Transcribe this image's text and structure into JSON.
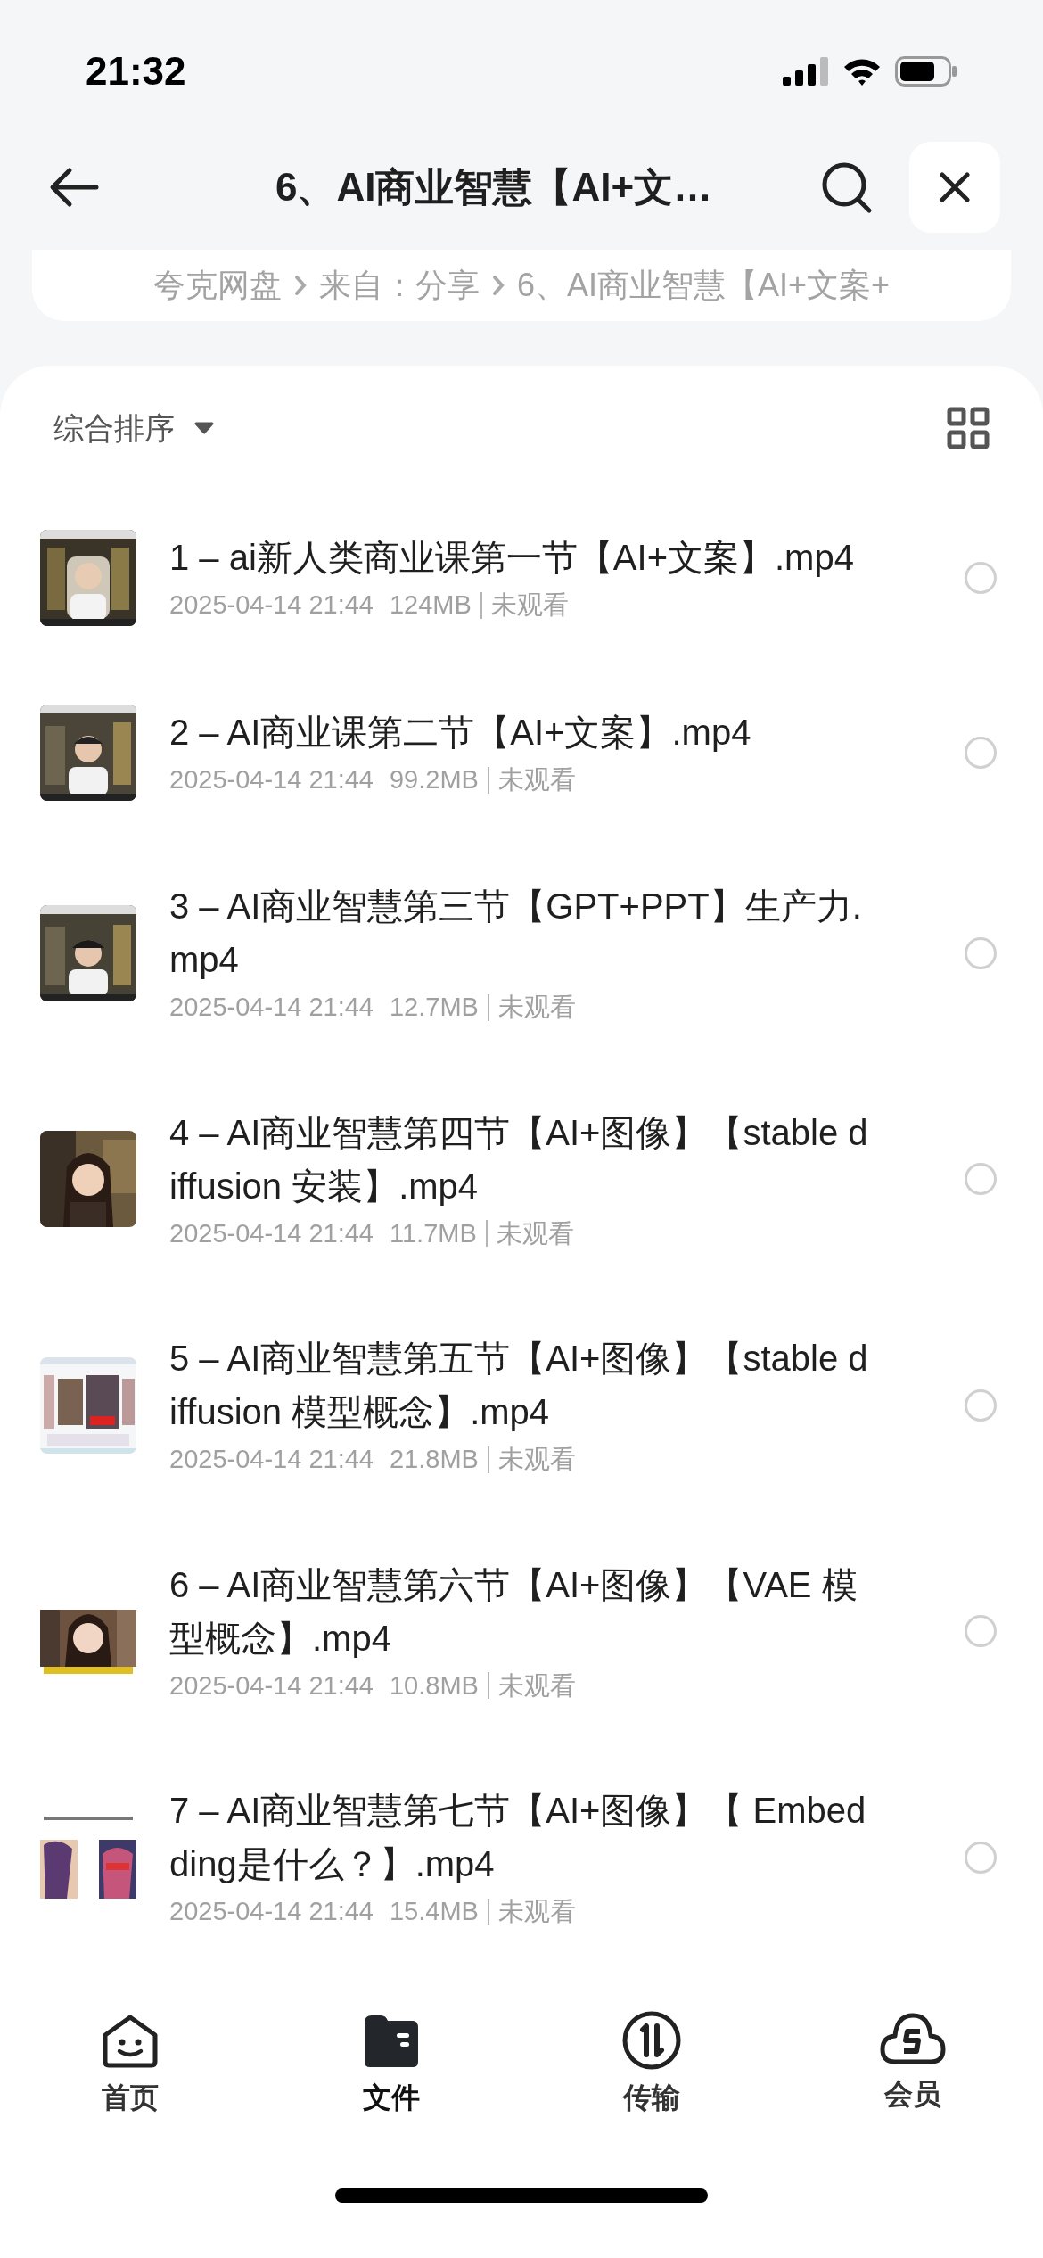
{
  "status_bar": {
    "time": "21:32"
  },
  "header": {
    "title": "6、AI商业智慧【AI+文…"
  },
  "breadcrumb": [
    "夸克网盘",
    "来自：分享",
    "6、AI商业智慧【AI+文案+"
  ],
  "sort": {
    "label": "综合排序"
  },
  "files": [
    {
      "name": "1 – ai新人类商业课第一节【AI+文案】.mp4",
      "date": "2025-04-14 21:44",
      "size": "124MB",
      "watch": "未观看",
      "checked": false
    },
    {
      "name": "2 – AI商业课第二节【AI+文案】.mp4",
      "date": "2025-04-14 21:44",
      "size": "99.2MB",
      "watch": "未观看",
      "checked": false
    },
    {
      "name": "3 – AI商业智慧第三节【GPT+PPT】生产力.mp4",
      "date": "2025-04-14 21:44",
      "size": "12.7MB",
      "watch": "未观看",
      "checked": false
    },
    {
      "name": "4 – AI商业智慧第四节【AI+图像】【stable diffusion 安装】.mp4",
      "date": "2025-04-14 21:44",
      "size": "11.7MB",
      "watch": "未观看",
      "checked": false
    },
    {
      "name": "5 – AI商业智慧第五节【AI+图像】【stable diffusion 模型概念】.mp4",
      "date": "2025-04-14 21:44",
      "size": "21.8MB",
      "watch": "未观看",
      "checked": false
    },
    {
      "name": "6 – AI商业智慧第六节【AI+图像】【VAE 模型概念】.mp4",
      "date": "2025-04-14 21:44",
      "size": "10.8MB",
      "watch": "未观看",
      "checked": false
    },
    {
      "name": "7 – AI商业智慧第七节【AI+图像】【 Embedding是什么？】.mp4",
      "date": "2025-04-14 21:44",
      "size": "15.4MB",
      "watch": "未观看",
      "checked": false
    }
  ],
  "tab_bar": [
    {
      "kind": "home",
      "label": "首页",
      "selected": false
    },
    {
      "kind": "files",
      "label": "文件",
      "selected": true
    },
    {
      "kind": "transfer",
      "label": "传输",
      "selected": false
    },
    {
      "kind": "member",
      "label": "会员",
      "selected": false
    }
  ]
}
